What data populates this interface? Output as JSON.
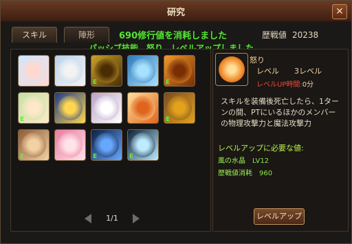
{
  "window": {
    "title": "研究",
    "close_label": "✕"
  },
  "tabs": [
    {
      "label": "スキル",
      "active": true
    },
    {
      "label": "陣形",
      "active": false
    }
  ],
  "messages": {
    "line1": "690修行値を消耗しました",
    "line2": "パッシブ技能　怒り　レベルアップしました"
  },
  "experience": {
    "label": "歴戦値",
    "value": "20238"
  },
  "grid": {
    "slots": [
      {
        "icon": "cheering-person-icon",
        "colors": [
          "#cfe7ff",
          "#ffd8d0"
        ],
        "badge": ""
      },
      {
        "icon": "white-figure-icon",
        "colors": [
          "#b9d1ea",
          "#f3f3f3"
        ],
        "badge": ""
      },
      {
        "icon": "golden-warrior-icon",
        "colors": [
          "#c9a12a",
          "#4a2d05"
        ],
        "badge": "E"
      },
      {
        "icon": "holy-star-person-icon",
        "colors": [
          "#2e7ab8",
          "#a8e0ff"
        ],
        "badge": ""
      },
      {
        "icon": "spinning-sword-icon",
        "colors": [
          "#f09a2a",
          "#7a2e05"
        ],
        "badge": "E"
      },
      {
        "icon": "halo-face-icon",
        "colors": [
          "#bfe2a6",
          "#ffe7c7"
        ],
        "badge": "E"
      },
      {
        "icon": "sun-face-icon",
        "colors": [
          "#1a3a8c",
          "#ffd650"
        ],
        "badge": ""
      },
      {
        "icon": "cloud-angel-icon",
        "colors": [
          "#b8a2c8",
          "#ffffff"
        ],
        "badge": ""
      },
      {
        "icon": "flaming-face-icon",
        "colors": [
          "#ffdf9a",
          "#e0641e"
        ],
        "badge": ""
      },
      {
        "icon": "golden-shield-icon",
        "colors": [
          "#7a4a20",
          "#e2a21e"
        ],
        "badge": "E"
      },
      {
        "icon": "priestess-portrait-icon",
        "colors": [
          "#8d5a35",
          "#f2d2a5"
        ],
        "badge": "E"
      },
      {
        "icon": "blossom-person-icon",
        "colors": [
          "#e87aa0",
          "#ffe3e8"
        ],
        "badge": ""
      },
      {
        "icon": "light-cross-icon",
        "colors": [
          "#0e1d40",
          "#67a8ff"
        ],
        "badge": "E"
      },
      {
        "icon": "sparkle-person-icon",
        "colors": [
          "#0c1e34",
          "#bdebff"
        ],
        "badge": "E"
      }
    ]
  },
  "pager": {
    "page": "1/1"
  },
  "skill": {
    "icon": "flaming-face-icon",
    "name": "怒り",
    "level_label": "レベル",
    "level_value": "3レベル",
    "time_label": "レベルUP時間:",
    "time_value": "0分",
    "description": "スキルを装備後死亡したら、1ターンの間、PTにいるほかのメンバーの物理攻撃力と魔法攻撃力",
    "req_title": "レベルアップに必要な値:",
    "req_items": [
      {
        "label": "風の水晶",
        "value": "LV12"
      },
      {
        "label": "歴戦値消耗",
        "value": "960"
      }
    ],
    "levelup_label": "レベルアップ"
  }
}
